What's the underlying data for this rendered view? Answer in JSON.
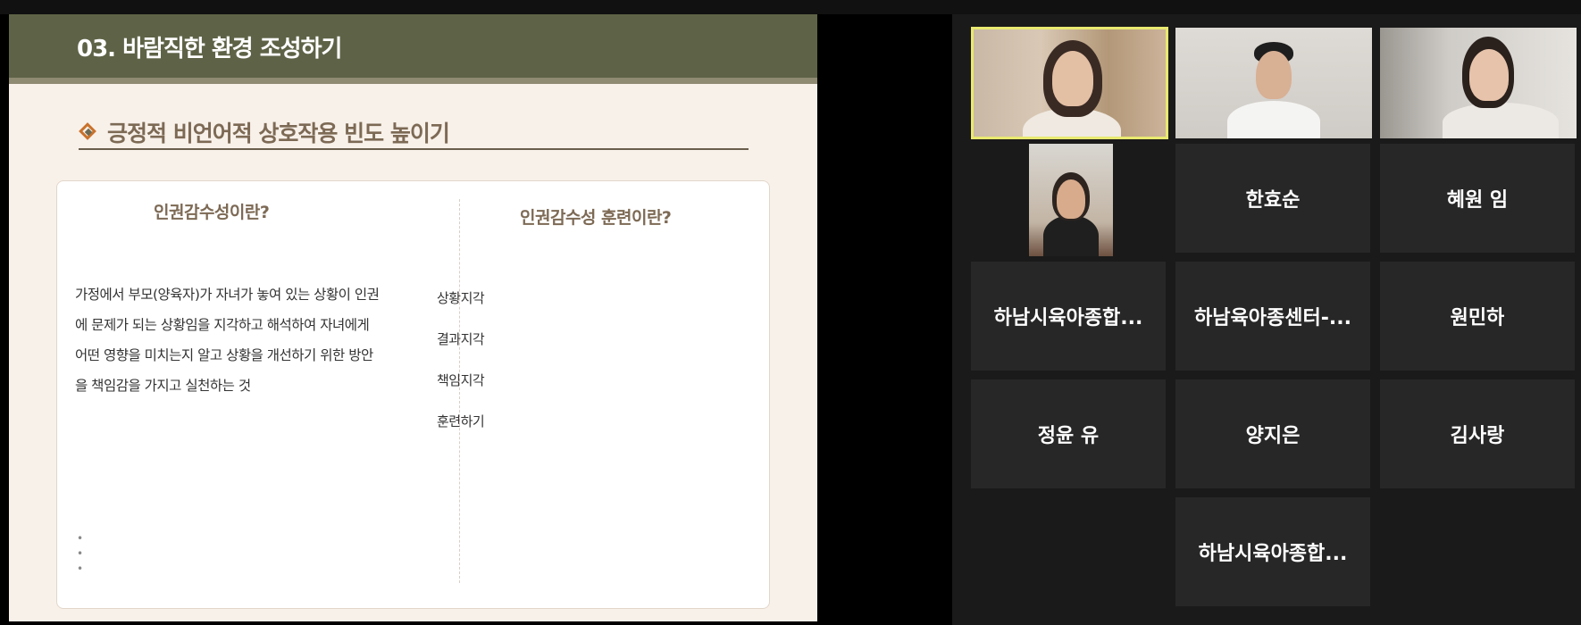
{
  "slide": {
    "title": "03. 바람직한 환경 조성하기",
    "subheading": "긍정적 비언어적 상호작용 빈도 높이기",
    "left_column": {
      "heading": "인권감수성이란?",
      "body": "가정에서 부모(양육자)가 자녀가 놓여 있는 상황이 인권에 문제가 되는 상황임을 지각하고 해석하여 자녀에게 어떤 영향을 미치는지 알고 상황을 개선하기 위한 방안을 책임감을 가지고 실천하는 것",
      "bullets": [
        "•",
        "•",
        "•"
      ]
    },
    "right_column": {
      "heading": "인권감수성 훈련이란?",
      "items": [
        "상황지각",
        "결과지각",
        "책임지각",
        "훈련하기"
      ]
    }
  },
  "participants": [
    "한효순",
    "혜원 임",
    "하남시육아종합...",
    "하남육아종센터-...",
    "원민하",
    "정윤 유",
    "양지은",
    "김사랑",
    "하남시육아종합..."
  ],
  "colors": {
    "header_bg": "#5e6347",
    "accent": "#c9722c",
    "heading_text": "#7d6a55",
    "active_speaker_border": "#e9e970",
    "tile_bg": "#272727"
  }
}
